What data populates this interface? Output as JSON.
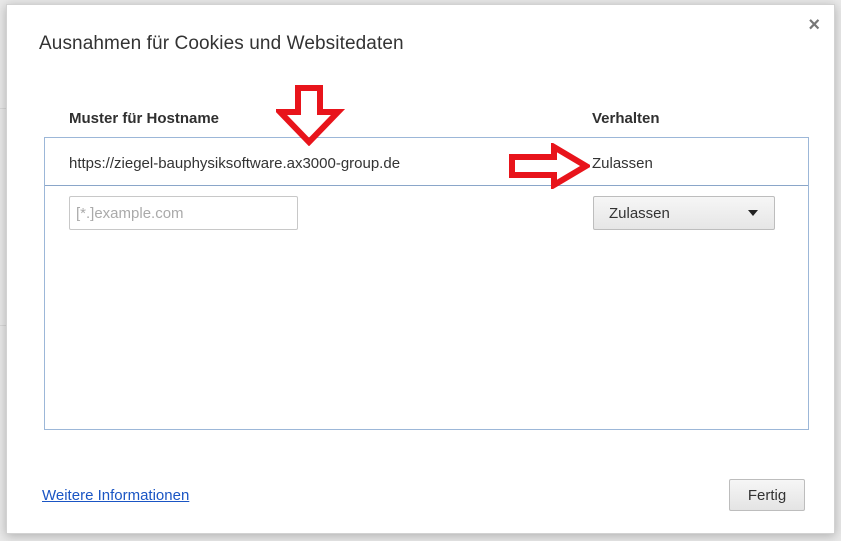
{
  "dialog": {
    "title": "Ausnahmen für Cookies und Websitedaten",
    "close_symbol": "×",
    "columns": {
      "host": "Muster für Hostname",
      "behavior": "Verhalten"
    },
    "entries": [
      {
        "host": "https://ziegel-bauphysiksoftware.ax3000-group.de",
        "behavior": "Zulassen"
      }
    ],
    "new_entry": {
      "placeholder": "[*.]example.com",
      "behavior_selected": "Zulassen"
    },
    "more_info_link": "Weitere Informationen",
    "done_button": "Fertig"
  },
  "annotations": {
    "color": "#e8141b",
    "arrows": [
      "arrow-down",
      "arrow-right"
    ]
  },
  "icons": {
    "close": "close-icon",
    "dropdown": "chevron-down-icon"
  }
}
